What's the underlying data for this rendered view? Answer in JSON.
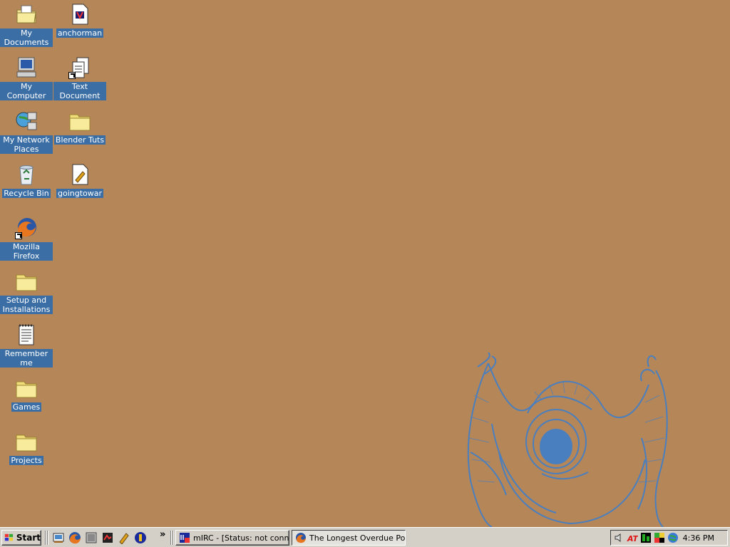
{
  "desktop": {
    "icons": [
      {
        "label": "My Documents",
        "icon": "my-documents-icon"
      },
      {
        "label": "anchorman",
        "icon": "media-file-icon"
      },
      {
        "label": "My Computer",
        "icon": "my-computer-icon"
      },
      {
        "label": "Text Document",
        "icon": "text-document-shortcut-icon"
      },
      {
        "label": "My Network Places",
        "icon": "network-places-icon"
      },
      {
        "label": "Blender Tuts",
        "icon": "folder-icon"
      },
      {
        "label": "Recycle Bin",
        "icon": "recycle-bin-icon"
      },
      {
        "label": "goingtowar",
        "icon": "script-file-icon"
      },
      {
        "label": "Mozilla Firefox",
        "icon": "firefox-icon"
      },
      {
        "label": "Setup and Installations",
        "icon": "folder-icon"
      },
      {
        "label": "Remember me",
        "icon": "notepad-document-icon"
      },
      {
        "label": "Games",
        "icon": "folder-icon"
      },
      {
        "label": "Projects",
        "icon": "folder-icon"
      }
    ],
    "background_color": "#b58658",
    "wallpaper_art_color": "#4a7fbf"
  },
  "taskbar": {
    "start_label": "Start",
    "quick_launch": [
      "show-desktop-icon",
      "firefox-icon",
      "app-icon",
      "media-player-icon",
      "script-icon",
      "misc-app-icon"
    ],
    "more_label": "»",
    "tasks": [
      {
        "label": "mIRC - [Status: not conn...",
        "icon": "mirc-icon",
        "active": false
      },
      {
        "label": "The Longest Overdue Po...",
        "icon": "firefox-icon",
        "active": true
      }
    ],
    "tray_icons": [
      "volume-icon",
      "ati-icon",
      "meter-icon",
      "color-app-icon",
      "network-globe-icon"
    ],
    "clock": "4:36 PM"
  }
}
